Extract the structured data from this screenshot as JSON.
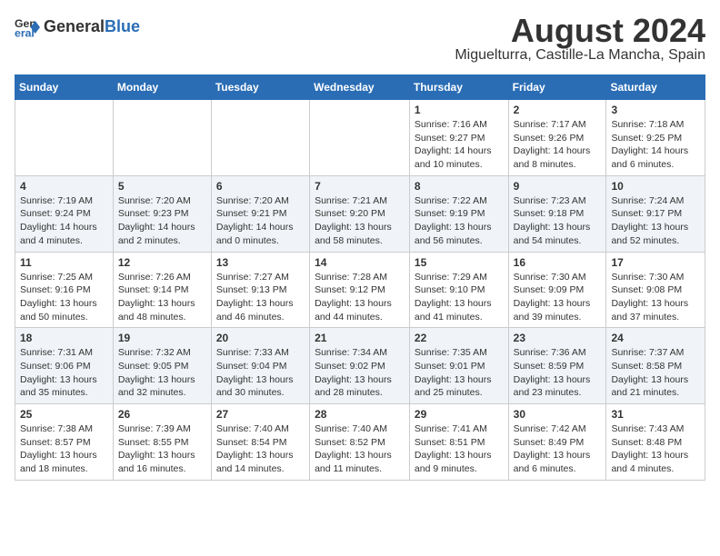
{
  "logo": {
    "line1": "General",
    "line2": "Blue"
  },
  "title": "August 2024",
  "subtitle": "Miguelturra, Castille-La Mancha, Spain",
  "headers": [
    "Sunday",
    "Monday",
    "Tuesday",
    "Wednesday",
    "Thursday",
    "Friday",
    "Saturday"
  ],
  "weeks": [
    [
      {
        "day": "",
        "info": ""
      },
      {
        "day": "",
        "info": ""
      },
      {
        "day": "",
        "info": ""
      },
      {
        "day": "",
        "info": ""
      },
      {
        "day": "1",
        "info": "Sunrise: 7:16 AM\nSunset: 9:27 PM\nDaylight: 14 hours\nand 10 minutes."
      },
      {
        "day": "2",
        "info": "Sunrise: 7:17 AM\nSunset: 9:26 PM\nDaylight: 14 hours\nand 8 minutes."
      },
      {
        "day": "3",
        "info": "Sunrise: 7:18 AM\nSunset: 9:25 PM\nDaylight: 14 hours\nand 6 minutes."
      }
    ],
    [
      {
        "day": "4",
        "info": "Sunrise: 7:19 AM\nSunset: 9:24 PM\nDaylight: 14 hours\nand 4 minutes."
      },
      {
        "day": "5",
        "info": "Sunrise: 7:20 AM\nSunset: 9:23 PM\nDaylight: 14 hours\nand 2 minutes."
      },
      {
        "day": "6",
        "info": "Sunrise: 7:20 AM\nSunset: 9:21 PM\nDaylight: 14 hours\nand 0 minutes."
      },
      {
        "day": "7",
        "info": "Sunrise: 7:21 AM\nSunset: 9:20 PM\nDaylight: 13 hours\nand 58 minutes."
      },
      {
        "day": "8",
        "info": "Sunrise: 7:22 AM\nSunset: 9:19 PM\nDaylight: 13 hours\nand 56 minutes."
      },
      {
        "day": "9",
        "info": "Sunrise: 7:23 AM\nSunset: 9:18 PM\nDaylight: 13 hours\nand 54 minutes."
      },
      {
        "day": "10",
        "info": "Sunrise: 7:24 AM\nSunset: 9:17 PM\nDaylight: 13 hours\nand 52 minutes."
      }
    ],
    [
      {
        "day": "11",
        "info": "Sunrise: 7:25 AM\nSunset: 9:16 PM\nDaylight: 13 hours\nand 50 minutes."
      },
      {
        "day": "12",
        "info": "Sunrise: 7:26 AM\nSunset: 9:14 PM\nDaylight: 13 hours\nand 48 minutes."
      },
      {
        "day": "13",
        "info": "Sunrise: 7:27 AM\nSunset: 9:13 PM\nDaylight: 13 hours\nand 46 minutes."
      },
      {
        "day": "14",
        "info": "Sunrise: 7:28 AM\nSunset: 9:12 PM\nDaylight: 13 hours\nand 44 minutes."
      },
      {
        "day": "15",
        "info": "Sunrise: 7:29 AM\nSunset: 9:10 PM\nDaylight: 13 hours\nand 41 minutes."
      },
      {
        "day": "16",
        "info": "Sunrise: 7:30 AM\nSunset: 9:09 PM\nDaylight: 13 hours\nand 39 minutes."
      },
      {
        "day": "17",
        "info": "Sunrise: 7:30 AM\nSunset: 9:08 PM\nDaylight: 13 hours\nand 37 minutes."
      }
    ],
    [
      {
        "day": "18",
        "info": "Sunrise: 7:31 AM\nSunset: 9:06 PM\nDaylight: 13 hours\nand 35 minutes."
      },
      {
        "day": "19",
        "info": "Sunrise: 7:32 AM\nSunset: 9:05 PM\nDaylight: 13 hours\nand 32 minutes."
      },
      {
        "day": "20",
        "info": "Sunrise: 7:33 AM\nSunset: 9:04 PM\nDaylight: 13 hours\nand 30 minutes."
      },
      {
        "day": "21",
        "info": "Sunrise: 7:34 AM\nSunset: 9:02 PM\nDaylight: 13 hours\nand 28 minutes."
      },
      {
        "day": "22",
        "info": "Sunrise: 7:35 AM\nSunset: 9:01 PM\nDaylight: 13 hours\nand 25 minutes."
      },
      {
        "day": "23",
        "info": "Sunrise: 7:36 AM\nSunset: 8:59 PM\nDaylight: 13 hours\nand 23 minutes."
      },
      {
        "day": "24",
        "info": "Sunrise: 7:37 AM\nSunset: 8:58 PM\nDaylight: 13 hours\nand 21 minutes."
      }
    ],
    [
      {
        "day": "25",
        "info": "Sunrise: 7:38 AM\nSunset: 8:57 PM\nDaylight: 13 hours\nand 18 minutes."
      },
      {
        "day": "26",
        "info": "Sunrise: 7:39 AM\nSunset: 8:55 PM\nDaylight: 13 hours\nand 16 minutes."
      },
      {
        "day": "27",
        "info": "Sunrise: 7:40 AM\nSunset: 8:54 PM\nDaylight: 13 hours\nand 14 minutes."
      },
      {
        "day": "28",
        "info": "Sunrise: 7:40 AM\nSunset: 8:52 PM\nDaylight: 13 hours\nand 11 minutes."
      },
      {
        "day": "29",
        "info": "Sunrise: 7:41 AM\nSunset: 8:51 PM\nDaylight: 13 hours\nand 9 minutes."
      },
      {
        "day": "30",
        "info": "Sunrise: 7:42 AM\nSunset: 8:49 PM\nDaylight: 13 hours\nand 6 minutes."
      },
      {
        "day": "31",
        "info": "Sunrise: 7:43 AM\nSunset: 8:48 PM\nDaylight: 13 hours\nand 4 minutes."
      }
    ]
  ]
}
